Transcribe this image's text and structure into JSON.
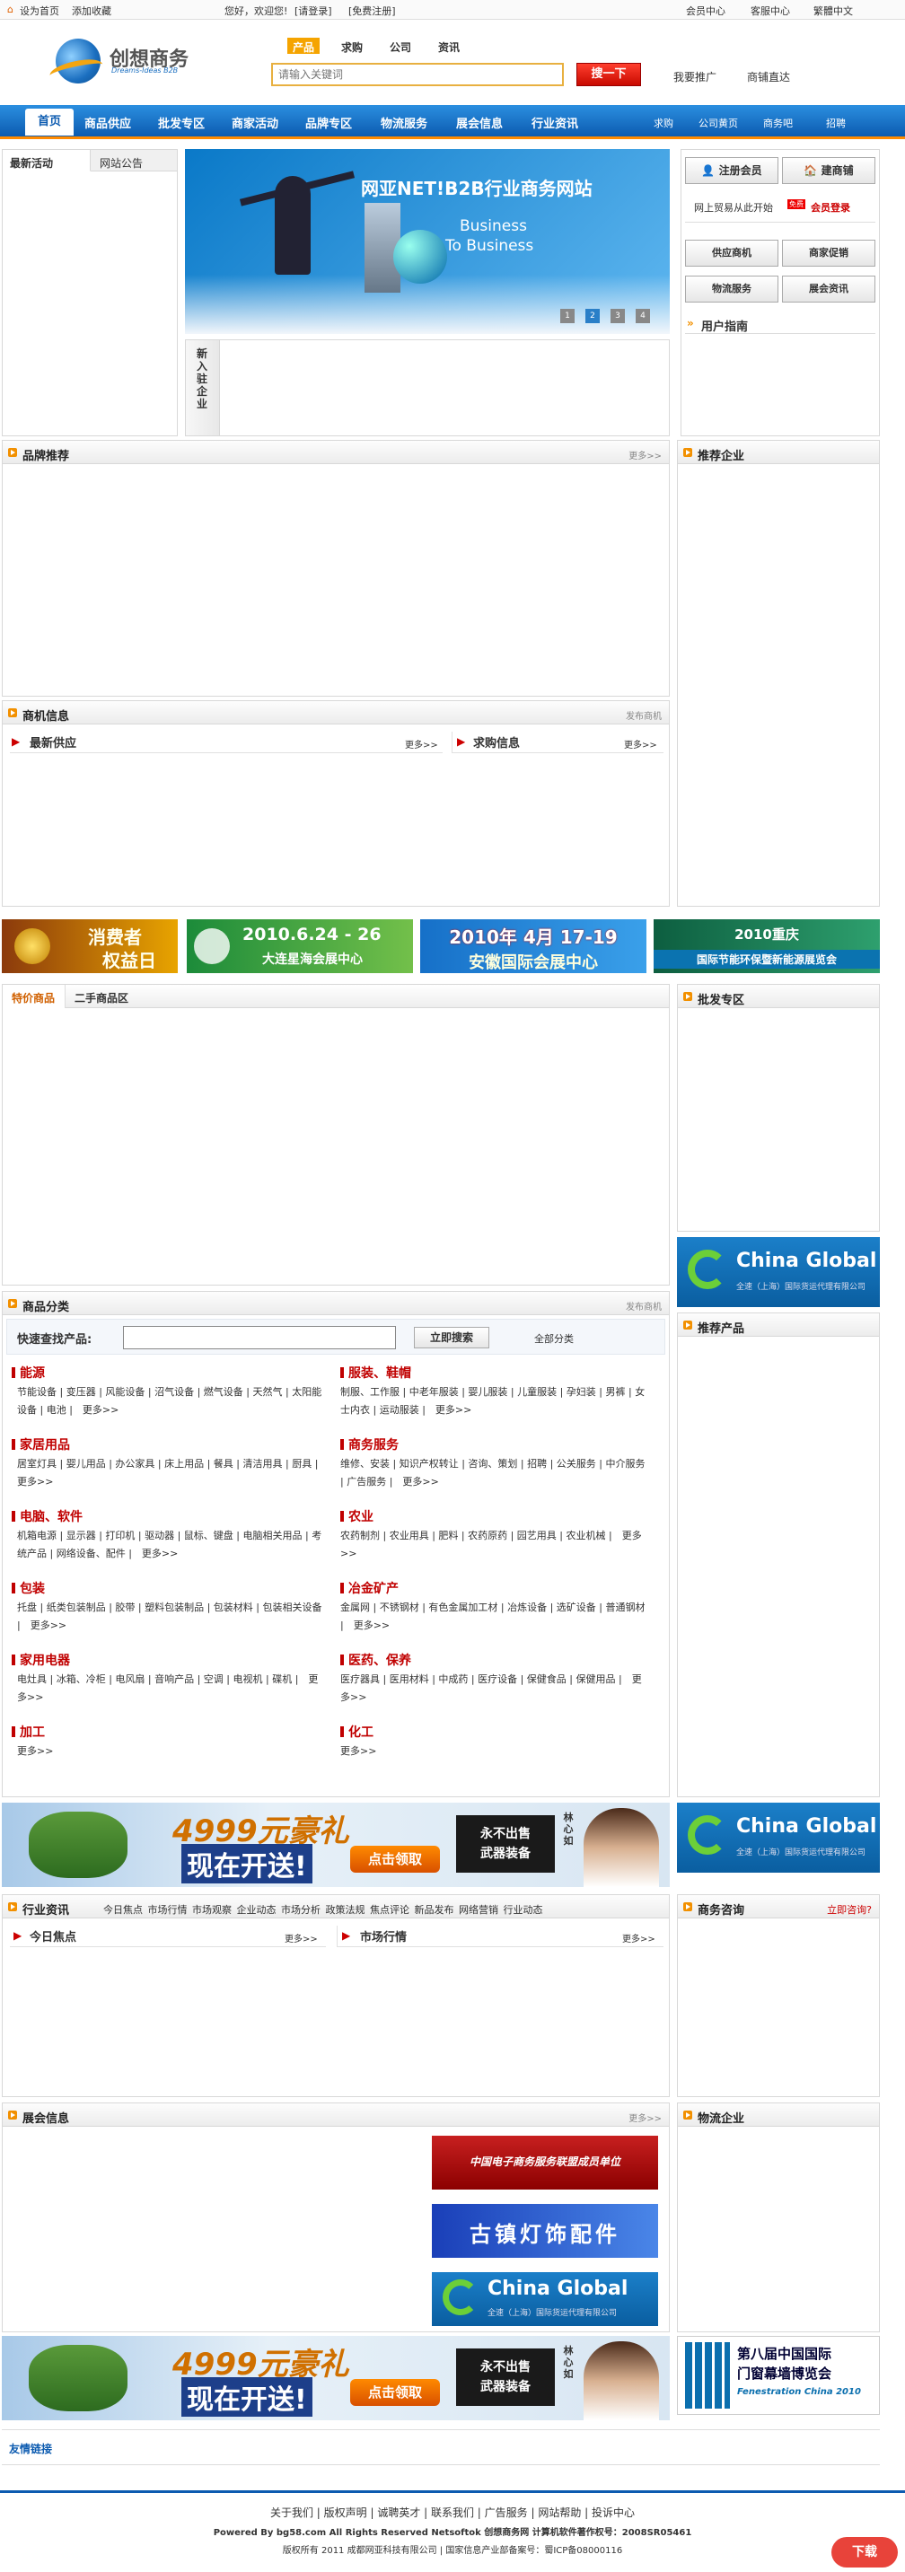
{
  "topbar": {
    "home": "设为首页",
    "fav": "添加收藏",
    "welcome": "您好，欢迎您!",
    "login": "[请登录]",
    "register": "[免费注册]",
    "member": "会员中心",
    "service": "客服中心",
    "trad": "繁體中文"
  },
  "logo": {
    "name": "创想商务",
    "slogan": "Dreams-Ideas B2B"
  },
  "search": {
    "tabs": [
      "产品",
      "求购",
      "公司",
      "资讯"
    ],
    "placeholder": "请输入关键词",
    "button": "搜一下",
    "promote": "我要推广",
    "direct": "商铺直达"
  },
  "nav": {
    "items": [
      "首页",
      "商品供应",
      "批发专区",
      "商家活动",
      "品牌专区",
      "物流服务",
      "展会信息",
      "行业资讯"
    ],
    "sub": [
      "求购",
      "公司黄页",
      "商务吧",
      "招聘"
    ]
  },
  "left_tabs": [
    "最新活动",
    "网站公告"
  ],
  "banner": {
    "title": "网亚NET!B2B行业商务网站",
    "sub1": "Business",
    "sub2": "To Business",
    "pages": [
      "1",
      "2",
      "3",
      "4"
    ]
  },
  "new_enterprise": "新入驻企业",
  "side": {
    "register": "注册会员",
    "shop": "建商铺",
    "login_note": "网上贸易从此开始",
    "new_badge": "免费",
    "member_login": "会员登录",
    "btns": [
      "供应商机",
      "商家促销",
      "物流服务",
      "展会资讯"
    ],
    "guide": "用户指南"
  },
  "sections": {
    "brand": "品牌推荐",
    "brand_more": "更多>>",
    "rec_ent": "推荐企业",
    "biz": "商机信息",
    "biz_more": "发布商机",
    "newest_supply": "最新供应",
    "buy_info": "求购信息",
    "more": "更多>>",
    "special": "特价商品",
    "second": "二手商品区",
    "wholesale": "批发专区",
    "goods_cat": "商品分类",
    "goods_more": "发布商机",
    "rec_prod": "推荐产品",
    "news": "行业资讯",
    "news_tabs": [
      "今日焦点",
      "市场行情",
      "市场观察",
      "企业动态",
      "市场分析",
      "政策法规",
      "焦点评论",
      "新品发布",
      "网络营销",
      "行业动态"
    ],
    "today": "今日焦点",
    "market": "市场行情",
    "consult": "商务咨询",
    "ask": "立即咨询?",
    "expo": "展会信息",
    "expo_more": "更多>>",
    "logistics": "物流企业",
    "links": "友情链接"
  },
  "ads": {
    "a1a": "消费者",
    "a1b": "权益日",
    "a2a": "2010.6.24 - 26",
    "a2b": "大连星海会展中心",
    "a3a": "2010年 4月 17-19",
    "a3b": "安徽国际会展中心",
    "a4a": "2010重庆",
    "a4b": "国际节能环保暨新能源展览会",
    "cg": "China Global",
    "cg_sub": "全速（上海）国际货运代理有限公司",
    "game_amt": "4999元豪礼",
    "game_now": "现在开送!",
    "game_btn": "点击领取",
    "game_r1": "永不出售",
    "game_r2": "武器装备",
    "game_r3": "林心如",
    "expo_a": "中国电子商务服务联盟成员单位",
    "expo_b": "古镇灯饰配件",
    "fen_a": "第八届中国国际",
    "fen_b": "门窗幕墙博览会",
    "fen_c": "Fenestration China 2010"
  },
  "quick": {
    "label": "快速查找产品:",
    "button": "立即搜索",
    "all": "全部分类"
  },
  "categories": [
    {
      "name": "能源",
      "items": "节能设备 | 变压器 | 风能设备 | 沼气设备 | 燃气设备 | 天然气 | 太阳能设备 | 电池 |　更多>>"
    },
    {
      "name": "服装、鞋帽",
      "items": "制服、工作服 | 中老年服装 | 婴儿服装 | 儿童服装 | 孕妇装 | 男裤 | 女士内衣 | 运动服装 |　更多>>"
    },
    {
      "name": "家居用品",
      "items": "居室灯具 | 婴儿用品 | 办公家具 | 床上用品 | 餐具 | 清洁用具 | 厨具 |　更多>>"
    },
    {
      "name": "商务服务",
      "items": "维修、安装 | 知识产权转让 | 咨询、策划 | 招聘 | 公关服务 | 中介服务 | 广告服务 |　更多>>"
    },
    {
      "name": "电脑、软件",
      "items": "机箱电源 | 显示器 | 打印机 | 驱动器 | 鼠标、键盘 | 电脑相关用品 | 考统产品 | 网络设备、配件 |　更多>>"
    },
    {
      "name": "农业",
      "items": "农药制剂 | 农业用具 | 肥料 | 农药原药 | 园艺用具 | 农业机械 |　更多>>"
    },
    {
      "name": "包装",
      "items": "托盘 | 纸类包装制品 | 胶带 | 塑料包装制品 | 包装材料 | 包装相关设备 |　更多>>"
    },
    {
      "name": "冶金矿产",
      "items": "金属网 | 不锈钢材 | 有色金属加工材 | 冶炼设备 | 选矿设备 | 普通钢材 |　更多>>"
    },
    {
      "name": "家用电器",
      "items": "电灶具 | 冰箱、冷柜 | 电风扇 | 音响产品 | 空调 | 电视机 | 碟机 |　更多>>"
    },
    {
      "name": "医药、保养",
      "items": "医疗器具 | 医用材料 | 中成药 | 医疗设备 | 保健食品 | 保健用品 |　更多>>"
    },
    {
      "name": "加工",
      "items": "更多>>"
    },
    {
      "name": "化工",
      "items": "更多>>"
    }
  ],
  "footer": {
    "links": "关于我们 | 版权声明 | 诚聘英才 | 联系我们 | 广告服务 | 网站帮助 | 投诉中心",
    "powered": "Powered By bg58.com All Rights Reserved Netsoftok 创想商务网 计算机软件著作权号：2008SR05461",
    "copy": "版权所有 2011 成都网亚科技有限公司 | 国家信息产业部备案号：蜀ICP备08000116",
    "xz": "下载"
  },
  "colors": {
    "accent": "#0c5bb0",
    "orange": "#f5a400",
    "red": "#c80a00"
  }
}
